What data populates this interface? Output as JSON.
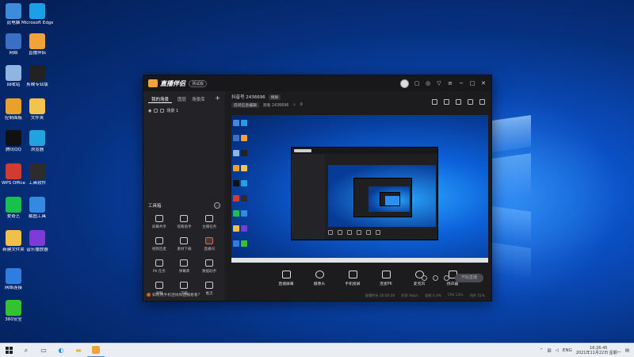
{
  "desktop": {
    "icons": [
      {
        "label": "此电脑",
        "color": "#3d8bd9"
      },
      {
        "label": "Microsoft Edge",
        "color": "#1ba0e8"
      },
      {
        "label": "网络",
        "color": "#3b6fc5"
      },
      {
        "label": "直播伴侣",
        "color": "#f2a23a"
      },
      {
        "label": "回收站",
        "color": "#8fb5e0"
      },
      {
        "label": "剪映专业版",
        "color": "#222222"
      },
      {
        "label": "控制面板",
        "color": "#e8a22b"
      },
      {
        "label": "文件夹",
        "color": "#f3c24f"
      },
      {
        "label": "腾讯QQ",
        "color": "#111111"
      },
      {
        "label": "浏览器",
        "color": "#23a2e0"
      },
      {
        "label": "WPS Office",
        "color": "#d23b2f"
      },
      {
        "label": "工具软件",
        "color": "#2c2c2c"
      },
      {
        "label": "爱奇艺",
        "color": "#18c14b"
      },
      {
        "label": "截图工具",
        "color": "#3489e0"
      },
      {
        "label": "新建文件夹",
        "color": "#f0c04a"
      },
      {
        "label": "音乐播放器",
        "color": "#7c3ad6"
      },
      {
        "label": "网络连接",
        "color": "#2f7de0"
      },
      {
        "label": "360安全",
        "color": "#35c230"
      }
    ]
  },
  "app": {
    "name": "直播伴侣",
    "version_badge": "测试版",
    "room_title": "抖音号 2436696",
    "room_tag": "横屏",
    "edit_btn": "房间信息编辑",
    "room_meta": "观看 2436696",
    "room_count": "0",
    "left_tabs": [
      "我的场景",
      "图层",
      "场景库"
    ],
    "add_label": "+",
    "scene_name": "场景 1",
    "toolbox_title": "工具箱",
    "tools": [
      {
        "label": "屏幕共享",
        "red": false
      },
      {
        "label": "观看助手",
        "red": false
      },
      {
        "label": "主播任务",
        "red": false
      },
      {
        "label": "视频连麦",
        "red": false
      },
      {
        "label": "素材下载",
        "red": false
      },
      {
        "label": "直播间",
        "red": true
      },
      {
        "label": "PK 任务",
        "red": false
      },
      {
        "label": "弹幕库",
        "red": false
      },
      {
        "label": "数据助手",
        "red": false
      },
      {
        "label": "录制",
        "red": false
      },
      {
        "label": "下载",
        "red": false
      },
      {
        "label": "推流",
        "red": false
      }
    ],
    "notice": "如何用手机连线和直播看看?",
    "actions": [
      {
        "label": "直播屏幕",
        "round": false
      },
      {
        "label": "摄像头",
        "round": true
      },
      {
        "label": "手机投屏",
        "round": false
      },
      {
        "label": "连麦PK",
        "round": false
      },
      {
        "label": "麦克风",
        "round": true
      },
      {
        "label": "扬声器",
        "round": false
      }
    ],
    "start_btn": "开始直播",
    "status": [
      "直播时长 00:00:00",
      "码率 0kb/s",
      "丢帧 0.0%",
      "CPU 13%",
      "内存 51%"
    ]
  },
  "taskbar": {
    "search_icon": "⌕",
    "tray_lang": "ENG",
    "time": "16:26:45",
    "date": "2021年11月22日 星期一"
  }
}
